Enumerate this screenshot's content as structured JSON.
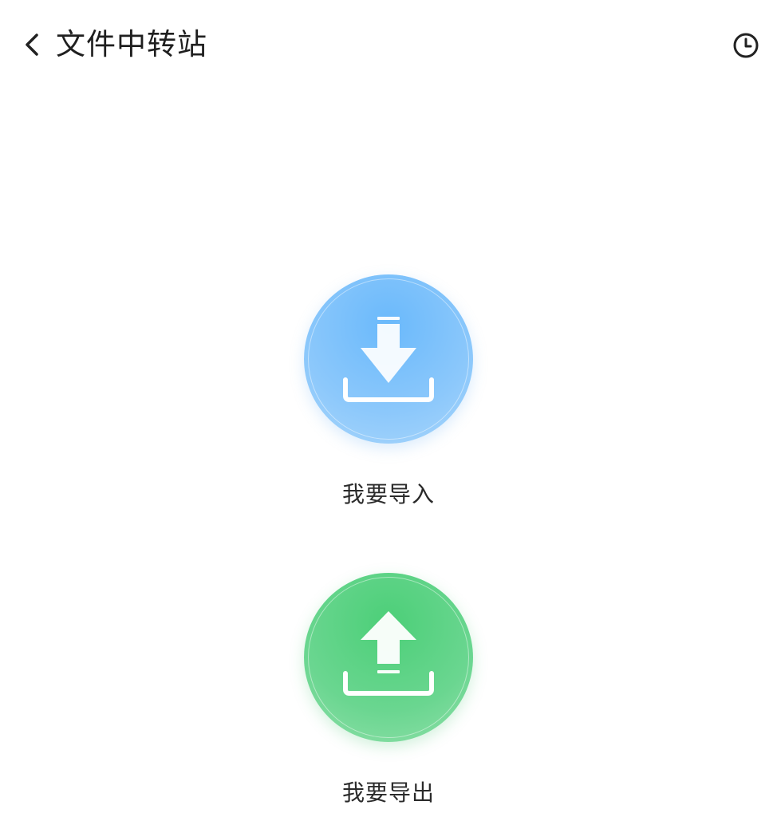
{
  "header": {
    "title": "文件中转站",
    "back_icon": "back-arrow-icon",
    "history_icon": "clock-history-icon"
  },
  "actions": [
    {
      "label": "我要导入",
      "icon": "download-tray-icon",
      "color": "#6ab9fb"
    },
    {
      "label": "我要导出",
      "icon": "upload-tray-icon",
      "color": "#4ccf78"
    }
  ]
}
